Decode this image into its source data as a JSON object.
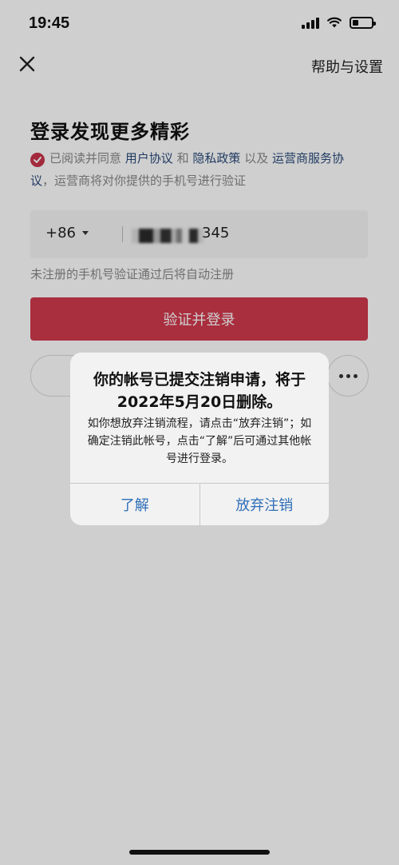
{
  "status_bar": {
    "time": "19:45"
  },
  "header": {
    "close_icon": "close-icon",
    "help_label": "帮助与设置"
  },
  "login": {
    "title": "登录发现更多精彩",
    "agreement": {
      "prefix": "已阅读并同意",
      "user_agreement": "用户协议",
      "and": "和",
      "privacy_policy": "隐私政策",
      "and_also": "以及",
      "carrier_terms": "运营商服务协议",
      "suffix": "，运营商将对你提供的手机号进行验证"
    },
    "phone": {
      "country_code": "+86",
      "value_visible_suffix": "345"
    },
    "auto_register_note": "未注册的手机号验证通过后将自动注册",
    "verify_button": "验证并登录"
  },
  "dialog": {
    "title": "你的帐号已提交注销申请，将于2022年5月20日删除。",
    "message": "如你想放弃注销流程，请点击“放弃注销”；如确定注销此帐号，点击“了解”后可通过其他帐号进行登录。",
    "buttons": {
      "ok": "了解",
      "cancel_deletion": "放弃注销"
    }
  },
  "colors": {
    "accent": "#d1394d",
    "link": "#2a4a7a",
    "dialog_button": "#2f6fb8"
  }
}
